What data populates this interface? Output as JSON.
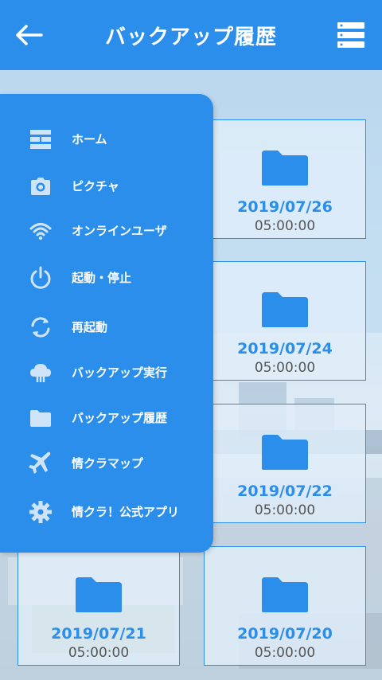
{
  "header": {
    "title": "バックアップ履歴",
    "back_icon": "back-arrow-icon",
    "menu_icon": "list-menu-icon"
  },
  "colors": {
    "primary": "#2b8eea",
    "text_muted": "#555555"
  },
  "menu": [
    {
      "label": "ホーム",
      "icon": "dashboard-icon"
    },
    {
      "label": "ピクチャ",
      "icon": "camera-icon"
    },
    {
      "label": "オンラインユーザ",
      "icon": "wifi-icon"
    },
    {
      "label": "起動・停止",
      "icon": "power-icon"
    },
    {
      "label": "再起動",
      "icon": "refresh-icon"
    },
    {
      "label": "バックアップ実行",
      "icon": "cloud-upload-icon"
    },
    {
      "label": "バックアップ履歴",
      "icon": "folder-icon"
    },
    {
      "label": "情クラマップ",
      "icon": "airplane-icon"
    },
    {
      "label": "情クラ！公式アプリ",
      "icon": "gear-icon"
    }
  ],
  "backups": [
    {
      "date": "2019/07/26",
      "time": "05:00:00"
    },
    {
      "date": "2019/07/24",
      "time": "05:00:00"
    },
    {
      "date": "2019/07/22",
      "time": "05:00:00"
    },
    {
      "date": "2019/07/21",
      "time": "05:00:00"
    },
    {
      "date": "2019/07/20",
      "time": "05:00:00"
    }
  ]
}
